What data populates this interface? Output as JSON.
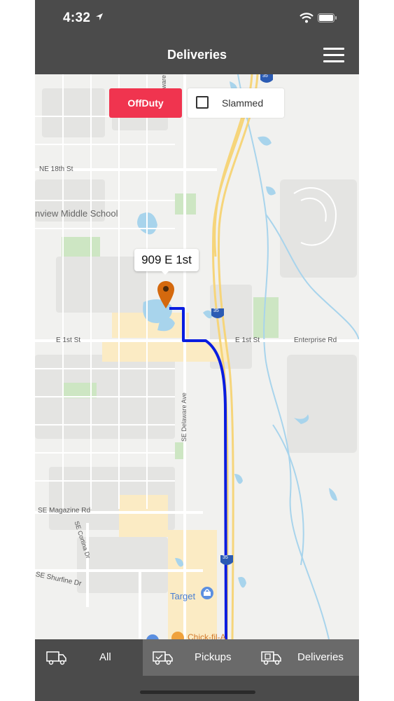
{
  "status_bar": {
    "time": "4:32"
  },
  "header": {
    "title": "Deliveries"
  },
  "controls": {
    "offduty_label": "OffDuty",
    "slammed_label": "Slammed",
    "slammed_checked": false
  },
  "map": {
    "callout": "909 E 1st",
    "labels": {
      "ne_18th": "NE 18th St",
      "school": "nview Middle School",
      "ne_delaware": "NE Delaware Ave",
      "e_1st_left": "E 1st St",
      "e_1st_right": "E 1st St",
      "enterprise": "Enterprise Rd",
      "se_delaware": "SE Delaware Ave",
      "se_magazine": "SE Magazine Rd",
      "se_cortina": "SE Cortina Dr",
      "se_shurfine": "SE Shurfine Dr",
      "target": "Target",
      "chick": "Chick-fil-A",
      "i35": "35"
    },
    "colors": {
      "route": "#0a1de0",
      "pin": "#d4690e",
      "highway": "#f6d57a",
      "water": "#a8d4ec",
      "park": "#cde6c3",
      "commercial": "#fbebc4"
    }
  },
  "tabs": [
    {
      "label": "All",
      "icon": "truck-icon",
      "active": true
    },
    {
      "label": "Pickups",
      "icon": "truck-check-icon",
      "active": false
    },
    {
      "label": "Deliveries",
      "icon": "truck-box-icon",
      "active": false
    }
  ],
  "accent_colors": {
    "offduty": "#f0344f",
    "bars": "#4b4b4b",
    "tab_inactive": "#6a6a6a"
  }
}
